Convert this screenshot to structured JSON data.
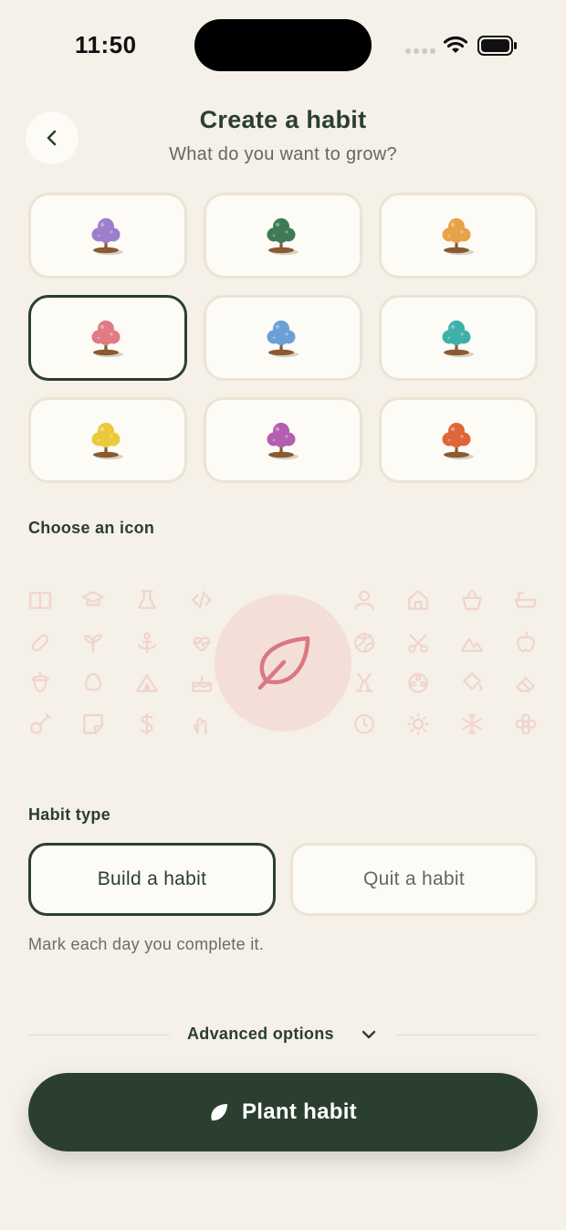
{
  "status": {
    "time": "11:50"
  },
  "header": {
    "title": "Create a habit",
    "subtitle": "What do you want to grow?"
  },
  "trees": [
    {
      "name": "purple",
      "color": "#9b7fcb",
      "selected": false
    },
    {
      "name": "green",
      "color": "#3d7a55",
      "selected": false
    },
    {
      "name": "orange",
      "color": "#e8a34a",
      "selected": false
    },
    {
      "name": "pink",
      "color": "#e07b86",
      "selected": true
    },
    {
      "name": "blue",
      "color": "#6a9fd8",
      "selected": false
    },
    {
      "name": "teal",
      "color": "#3fb0a8",
      "selected": false
    },
    {
      "name": "yellow",
      "color": "#ecc93a",
      "selected": false
    },
    {
      "name": "magenta",
      "color": "#b25fb0",
      "selected": false
    },
    {
      "name": "red-orange",
      "color": "#e0663a",
      "selected": false
    }
  ],
  "icon_section": {
    "label": "Choose an icon",
    "selected_icon": "leaf-icon"
  },
  "habit_type": {
    "label": "Habit type",
    "build_label": "Build a habit",
    "quit_label": "Quit a habit",
    "selected": "build",
    "hint": "Mark each day you complete it."
  },
  "advanced": {
    "label": "Advanced options"
  },
  "cta": {
    "label": "Plant habit"
  },
  "colors": {
    "background": "#f5f0e8",
    "primary": "#2b3f2f",
    "card": "#fdfbf6",
    "card_border": "#ece4d3",
    "icon_faint": "#f0d4cc",
    "icon_accent": "#d97880"
  }
}
